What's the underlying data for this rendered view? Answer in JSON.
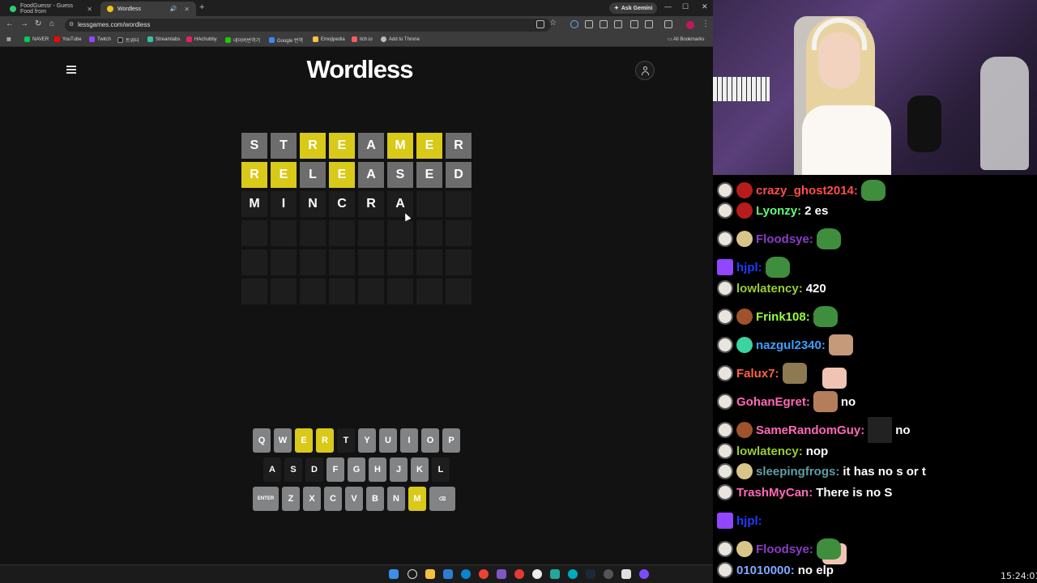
{
  "browser": {
    "tabs": [
      {
        "title": "FoodGuessr - Guess Food from",
        "active": false
      },
      {
        "title": "Wordless",
        "active": true
      }
    ],
    "gemini_label": "Ask Gemini",
    "url": "lessgames.com/wordless",
    "bookmarks": [
      "NAVER",
      "YouTube",
      "Twitch",
      "트위터",
      "Streamlabs",
      "HAchubby",
      "네이버번역기",
      "Google 번역",
      "Emojipedia",
      "itch.io",
      "Add to Throne"
    ],
    "all_bookmarks": "All Bookmarks"
  },
  "game": {
    "title": "Wordless",
    "board": [
      [
        {
          "l": "S",
          "s": "absent"
        },
        {
          "l": "T",
          "s": "absent"
        },
        {
          "l": "R",
          "s": "present"
        },
        {
          "l": "E",
          "s": "present"
        },
        {
          "l": "A",
          "s": "absent"
        },
        {
          "l": "M",
          "s": "present"
        },
        {
          "l": "E",
          "s": "present"
        },
        {
          "l": "R",
          "s": "absent"
        }
      ],
      [
        {
          "l": "R",
          "s": "present"
        },
        {
          "l": "E",
          "s": "present"
        },
        {
          "l": "L",
          "s": "absent"
        },
        {
          "l": "E",
          "s": "present"
        },
        {
          "l": "A",
          "s": "absent"
        },
        {
          "l": "S",
          "s": "absent"
        },
        {
          "l": "E",
          "s": "absent"
        },
        {
          "l": "D",
          "s": "absent"
        }
      ],
      [
        {
          "l": "M",
          "s": "typed"
        },
        {
          "l": "I",
          "s": "typed"
        },
        {
          "l": "N",
          "s": "typed"
        },
        {
          "l": "C",
          "s": "typed"
        },
        {
          "l": "R",
          "s": "typed"
        },
        {
          "l": "A",
          "s": "typed"
        },
        {
          "l": "",
          "s": "empty"
        },
        {
          "l": "",
          "s": "empty"
        }
      ],
      [
        {
          "l": "",
          "s": "empty"
        },
        {
          "l": "",
          "s": "empty"
        },
        {
          "l": "",
          "s": "empty"
        },
        {
          "l": "",
          "s": "empty"
        },
        {
          "l": "",
          "s": "empty"
        },
        {
          "l": "",
          "s": "empty"
        },
        {
          "l": "",
          "s": "empty"
        },
        {
          "l": "",
          "s": "empty"
        }
      ],
      [
        {
          "l": "",
          "s": "empty"
        },
        {
          "l": "",
          "s": "empty"
        },
        {
          "l": "",
          "s": "empty"
        },
        {
          "l": "",
          "s": "empty"
        },
        {
          "l": "",
          "s": "empty"
        },
        {
          "l": "",
          "s": "empty"
        },
        {
          "l": "",
          "s": "empty"
        },
        {
          "l": "",
          "s": "empty"
        }
      ],
      [
        {
          "l": "",
          "s": "empty"
        },
        {
          "l": "",
          "s": "empty"
        },
        {
          "l": "",
          "s": "empty"
        },
        {
          "l": "",
          "s": "empty"
        },
        {
          "l": "",
          "s": "empty"
        },
        {
          "l": "",
          "s": "empty"
        },
        {
          "l": "",
          "s": "empty"
        },
        {
          "l": "",
          "s": "empty"
        }
      ]
    ],
    "keyboard": [
      [
        {
          "k": "Q",
          "s": "unused"
        },
        {
          "k": "W",
          "s": "unused"
        },
        {
          "k": "E",
          "s": "present"
        },
        {
          "k": "R",
          "s": "present"
        },
        {
          "k": "T",
          "s": "absent"
        },
        {
          "k": "Y",
          "s": "unused"
        },
        {
          "k": "U",
          "s": "unused"
        },
        {
          "k": "I",
          "s": "unused"
        },
        {
          "k": "O",
          "s": "unused"
        },
        {
          "k": "P",
          "s": "unused"
        }
      ],
      [
        {
          "k": "A",
          "s": "absent"
        },
        {
          "k": "S",
          "s": "absent"
        },
        {
          "k": "D",
          "s": "absent"
        },
        {
          "k": "F",
          "s": "unused"
        },
        {
          "k": "G",
          "s": "unused"
        },
        {
          "k": "H",
          "s": "unused"
        },
        {
          "k": "J",
          "s": "unused"
        },
        {
          "k": "K",
          "s": "unused"
        },
        {
          "k": "L",
          "s": "absent"
        }
      ],
      [
        {
          "k": "ENTER",
          "s": "unused"
        },
        {
          "k": "Z",
          "s": "unused"
        },
        {
          "k": "X",
          "s": "unused"
        },
        {
          "k": "C",
          "s": "unused"
        },
        {
          "k": "V",
          "s": "unused"
        },
        {
          "k": "B",
          "s": "unused"
        },
        {
          "k": "N",
          "s": "unused"
        },
        {
          "k": "M",
          "s": "present"
        },
        {
          "k": "⌫",
          "s": "unused"
        }
      ]
    ]
  },
  "chat": [
    {
      "user": "crazy_ghost2014:",
      "color": "#ff4d4d",
      "text": "",
      "badges": [
        "b-dog",
        "b-sub"
      ],
      "emotes": [
        "frog"
      ]
    },
    {
      "user": "Lyonzy:",
      "color": "#5dff7a",
      "text": "2 es",
      "badges": [
        "b-dog",
        "b-sub"
      ],
      "emotes": []
    },
    {
      "user": "Floodsye:",
      "color": "#8a3cc8",
      "text": "",
      "badges": [
        "b-dog",
        "b-gold"
      ],
      "emotes": [
        "frog"
      ]
    },
    {
      "user": "hjpl:",
      "color": "#1e3cff",
      "text": "",
      "badges": [
        "b-prime"
      ],
      "emotes": [
        "frog"
      ]
    },
    {
      "user": "lowlatency:",
      "color": "#9acd32",
      "text": "420",
      "badges": [
        "b-dog"
      ],
      "emotes": []
    },
    {
      "user": "Frink108:",
      "color": "#9aff3a",
      "text": "",
      "badges": [
        "b-dog",
        "b-bowl"
      ],
      "emotes": [
        "frog"
      ]
    },
    {
      "user": "nazgul2340:",
      "color": "#3aa0ff",
      "text": "",
      "badges": [
        "b-dog",
        "b-green"
      ],
      "emotes": [
        "face",
        "cat"
      ]
    },
    {
      "user": "Falux7:",
      "color": "#ff6347",
      "text": "",
      "badges": [
        "b-dog"
      ],
      "emotes": [
        "toad"
      ]
    },
    {
      "user": "GohanEgret:",
      "color": "#ff69b4",
      "text": "no",
      "badges": [
        "b-dog"
      ],
      "emotes": [
        "hand"
      ]
    },
    {
      "user": "SameRandomGuy:",
      "color": "#ff69b4",
      "text": "no",
      "badges": [
        "b-dog",
        "b-bowl"
      ],
      "emotes": [
        "wide"
      ]
    },
    {
      "user": "lowlatency:",
      "color": "#9acd32",
      "text": "nop",
      "badges": [
        "b-dog"
      ],
      "emotes": []
    },
    {
      "user": "sleepingfrogs:",
      "color": "#5f9ea0",
      "text": "it has no s or t",
      "badges": [
        "b-dog",
        "b-gold"
      ],
      "emotes": []
    },
    {
      "user": "TrashMyCan:",
      "color": "#ff69b4",
      "text": "There is no S",
      "badges": [
        "b-dog"
      ],
      "emotes": []
    },
    {
      "user": "hjpl:",
      "color": "#1e3cff",
      "text": "",
      "badges": [
        "b-prime"
      ],
      "emotes": [
        "face"
      ]
    },
    {
      "user": "Floodsye:",
      "color": "#8a3cc8",
      "text": "",
      "badges": [
        "b-dog",
        "b-gold"
      ],
      "emotes": [
        "frog"
      ]
    },
    {
      "user": "01010000:",
      "color": "#7fa8ff",
      "text": "no elp",
      "badges": [
        "b-dog"
      ],
      "emotes": []
    }
  ],
  "clock": "15:24:01"
}
